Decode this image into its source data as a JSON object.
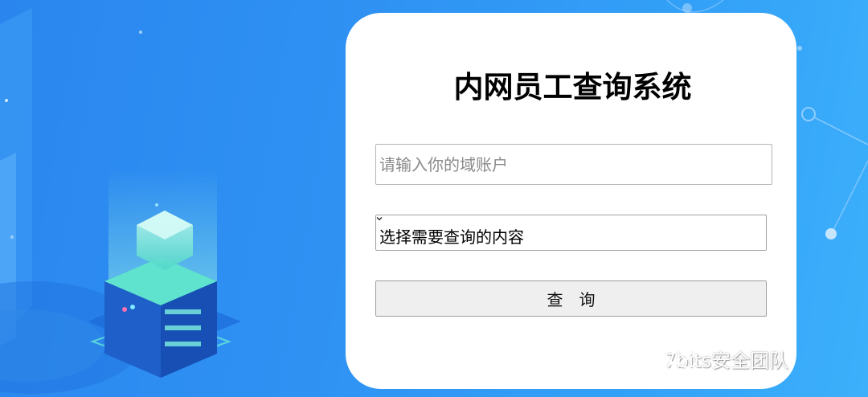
{
  "page": {
    "title": "内网员工查询系统"
  },
  "form": {
    "account_placeholder": "请输入你的域账户",
    "account_value": "",
    "select_selected": "选择需要查询的内容",
    "query_button_label": "查询"
  },
  "watermark": {
    "text": "7bits安全团队",
    "icon": "wechat-icon"
  },
  "colors": {
    "background": "#2f92f3",
    "card": "#ffffff",
    "button": "#efefef"
  }
}
